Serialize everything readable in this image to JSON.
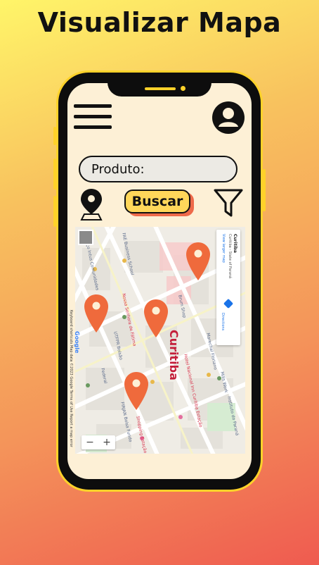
{
  "header": {
    "title": "Visualizar Mapa"
  },
  "search": {
    "product_label": "Produto:"
  },
  "actions": {
    "search_button": "Buscar"
  },
  "map": {
    "city_label": "Curitiba",
    "info_card": {
      "title": "Curitiba",
      "subtitle": "Curitiba - State of Paraná",
      "link": "View larger map",
      "directions": "Directions"
    },
    "streets": [
      "FAE Business School",
      "Espaço Intus Comunidades",
      "Nossa Senhora de Fátima",
      "UTFPR Bolsão",
      "Federal",
      "Hotel Nacional Inn Curitiba Estação",
      "Shopping Estação",
      "FIRJAN Bolsa Fundo",
      "Marechal Floriano",
      "Mills Work",
      "Instituto do Paraná",
      "Brum Shop"
    ],
    "zoom_in": "+",
    "zoom_out": "−",
    "google": "Google",
    "attribution": "Keyboard shortcuts   Map data ©2023 Google   Terms of Use   Report a map error"
  },
  "colors": {
    "accent": "#ffd22a",
    "pin": "#ef6a3c",
    "button": "#ffd75a",
    "screen": "#fdf0d6"
  },
  "icons": {
    "menu": "hamburger-icon",
    "profile": "user-avatar-icon",
    "location": "map-pin-icon",
    "filter": "filter-funnel-icon"
  }
}
